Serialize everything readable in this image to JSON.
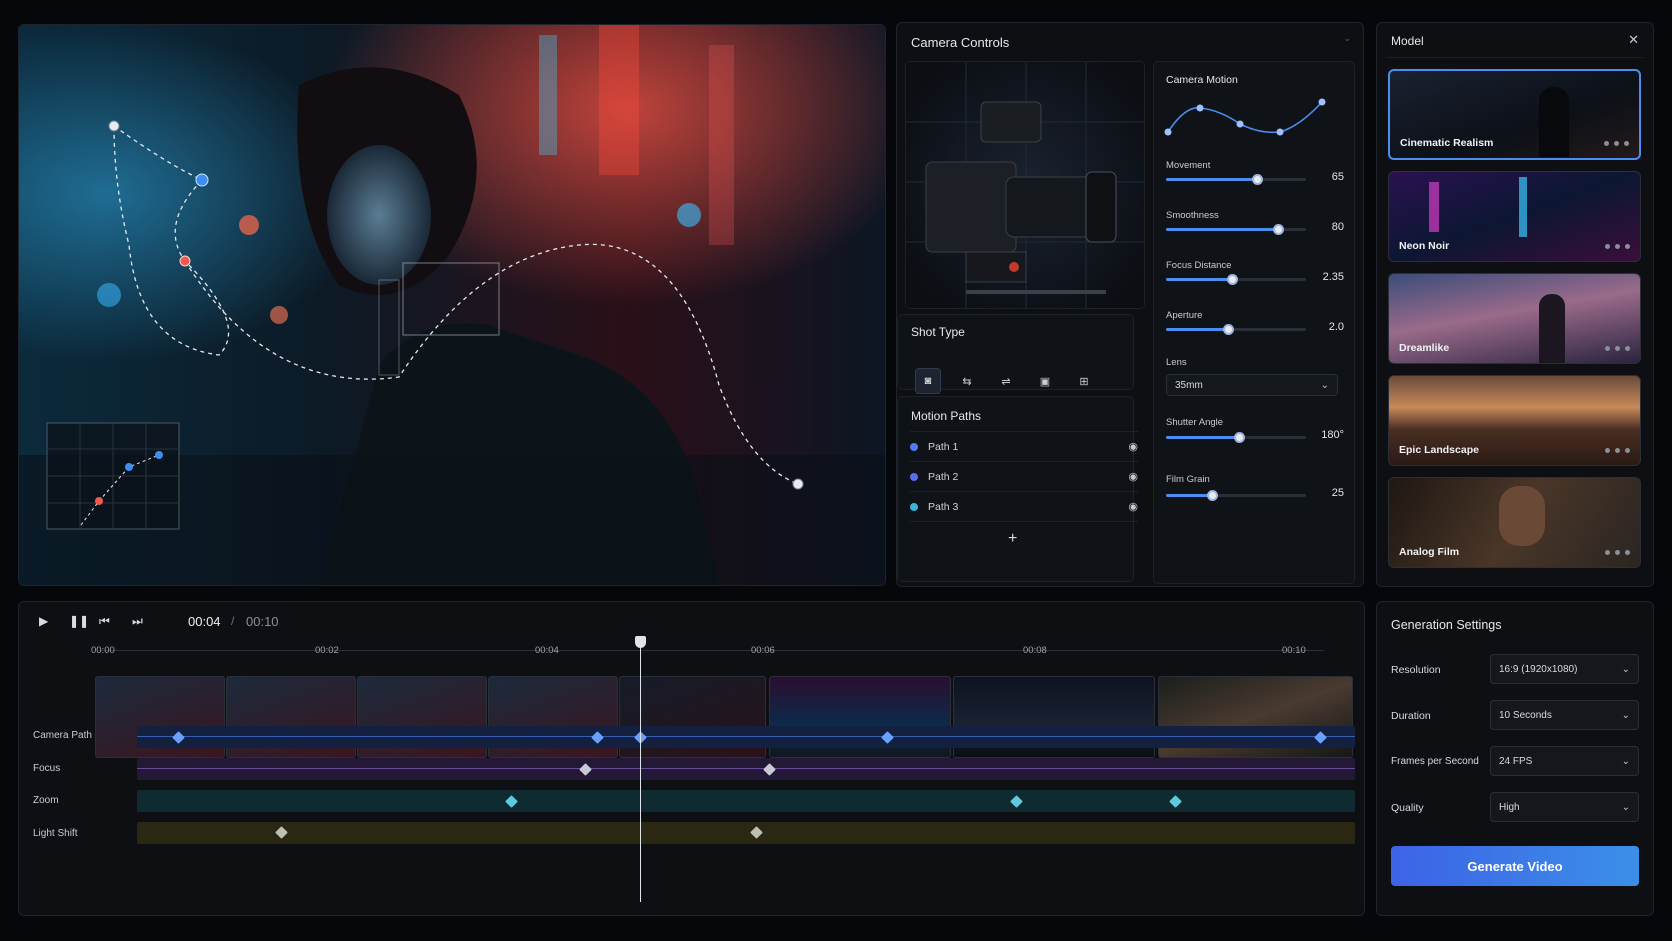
{
  "camera_controls": {
    "title": "Camera Controls",
    "camera_motion": {
      "title": "Camera Motion",
      "sliders": [
        {
          "label": "Movement",
          "value": "65",
          "level": 0.65
        },
        {
          "label": "Smoothness",
          "value": "80",
          "level": 0.8
        },
        {
          "label": "Focus Distance",
          "value": "2.35",
          "level": 0.47
        },
        {
          "label": "Aperture",
          "value": "2.0",
          "level": 0.44
        }
      ],
      "lens": {
        "label": "Lens",
        "value": "35mm"
      },
      "sliders2": [
        {
          "label": "Shutter Angle",
          "value": "180°",
          "level": 0.52
        },
        {
          "label": "Film Grain",
          "value": "25",
          "level": 0.33
        }
      ]
    },
    "shot_type": {
      "title": "Shot Type"
    },
    "motion_paths": {
      "title": "Motion Paths",
      "paths": [
        {
          "label": "Path 1",
          "color": "#4c7cf0"
        },
        {
          "label": "Path 2",
          "color": "#5a6cf0"
        },
        {
          "label": "Path 3",
          "color": "#35b5d8"
        }
      ],
      "add_label": "+"
    }
  },
  "model": {
    "title": "Model",
    "close": "✕",
    "items": [
      {
        "name": "Cinematic Realism",
        "selected": true
      },
      {
        "name": "Neon Noir"
      },
      {
        "name": "Dreamlike"
      },
      {
        "name": "Epic Landscape"
      },
      {
        "name": "Analog Film"
      }
    ]
  },
  "timeline": {
    "current_time": "00:04",
    "separator": "/",
    "total_time": "00:10",
    "ticks": [
      "00:00",
      "00:02",
      "00:04",
      "00:06",
      "00:08",
      "00:10"
    ],
    "tracks": [
      {
        "label": "Camera Path"
      },
      {
        "label": "Focus"
      },
      {
        "label": "Zoom"
      },
      {
        "label": "Light Shift"
      }
    ]
  },
  "generation": {
    "title": "Generation Settings",
    "fields": [
      {
        "label": "Resolution",
        "value": "16:9 (1920x1080)"
      },
      {
        "label": "Duration",
        "value": "10 Seconds"
      },
      {
        "label": "Frames per Second",
        "value": "24 FPS"
      },
      {
        "label": "Quality",
        "value": "High"
      }
    ],
    "button": "Generate Video"
  },
  "colors": {
    "accent": "#4c8ef0",
    "button_start": "#3d63e6",
    "button_end": "#3b8fe8"
  }
}
